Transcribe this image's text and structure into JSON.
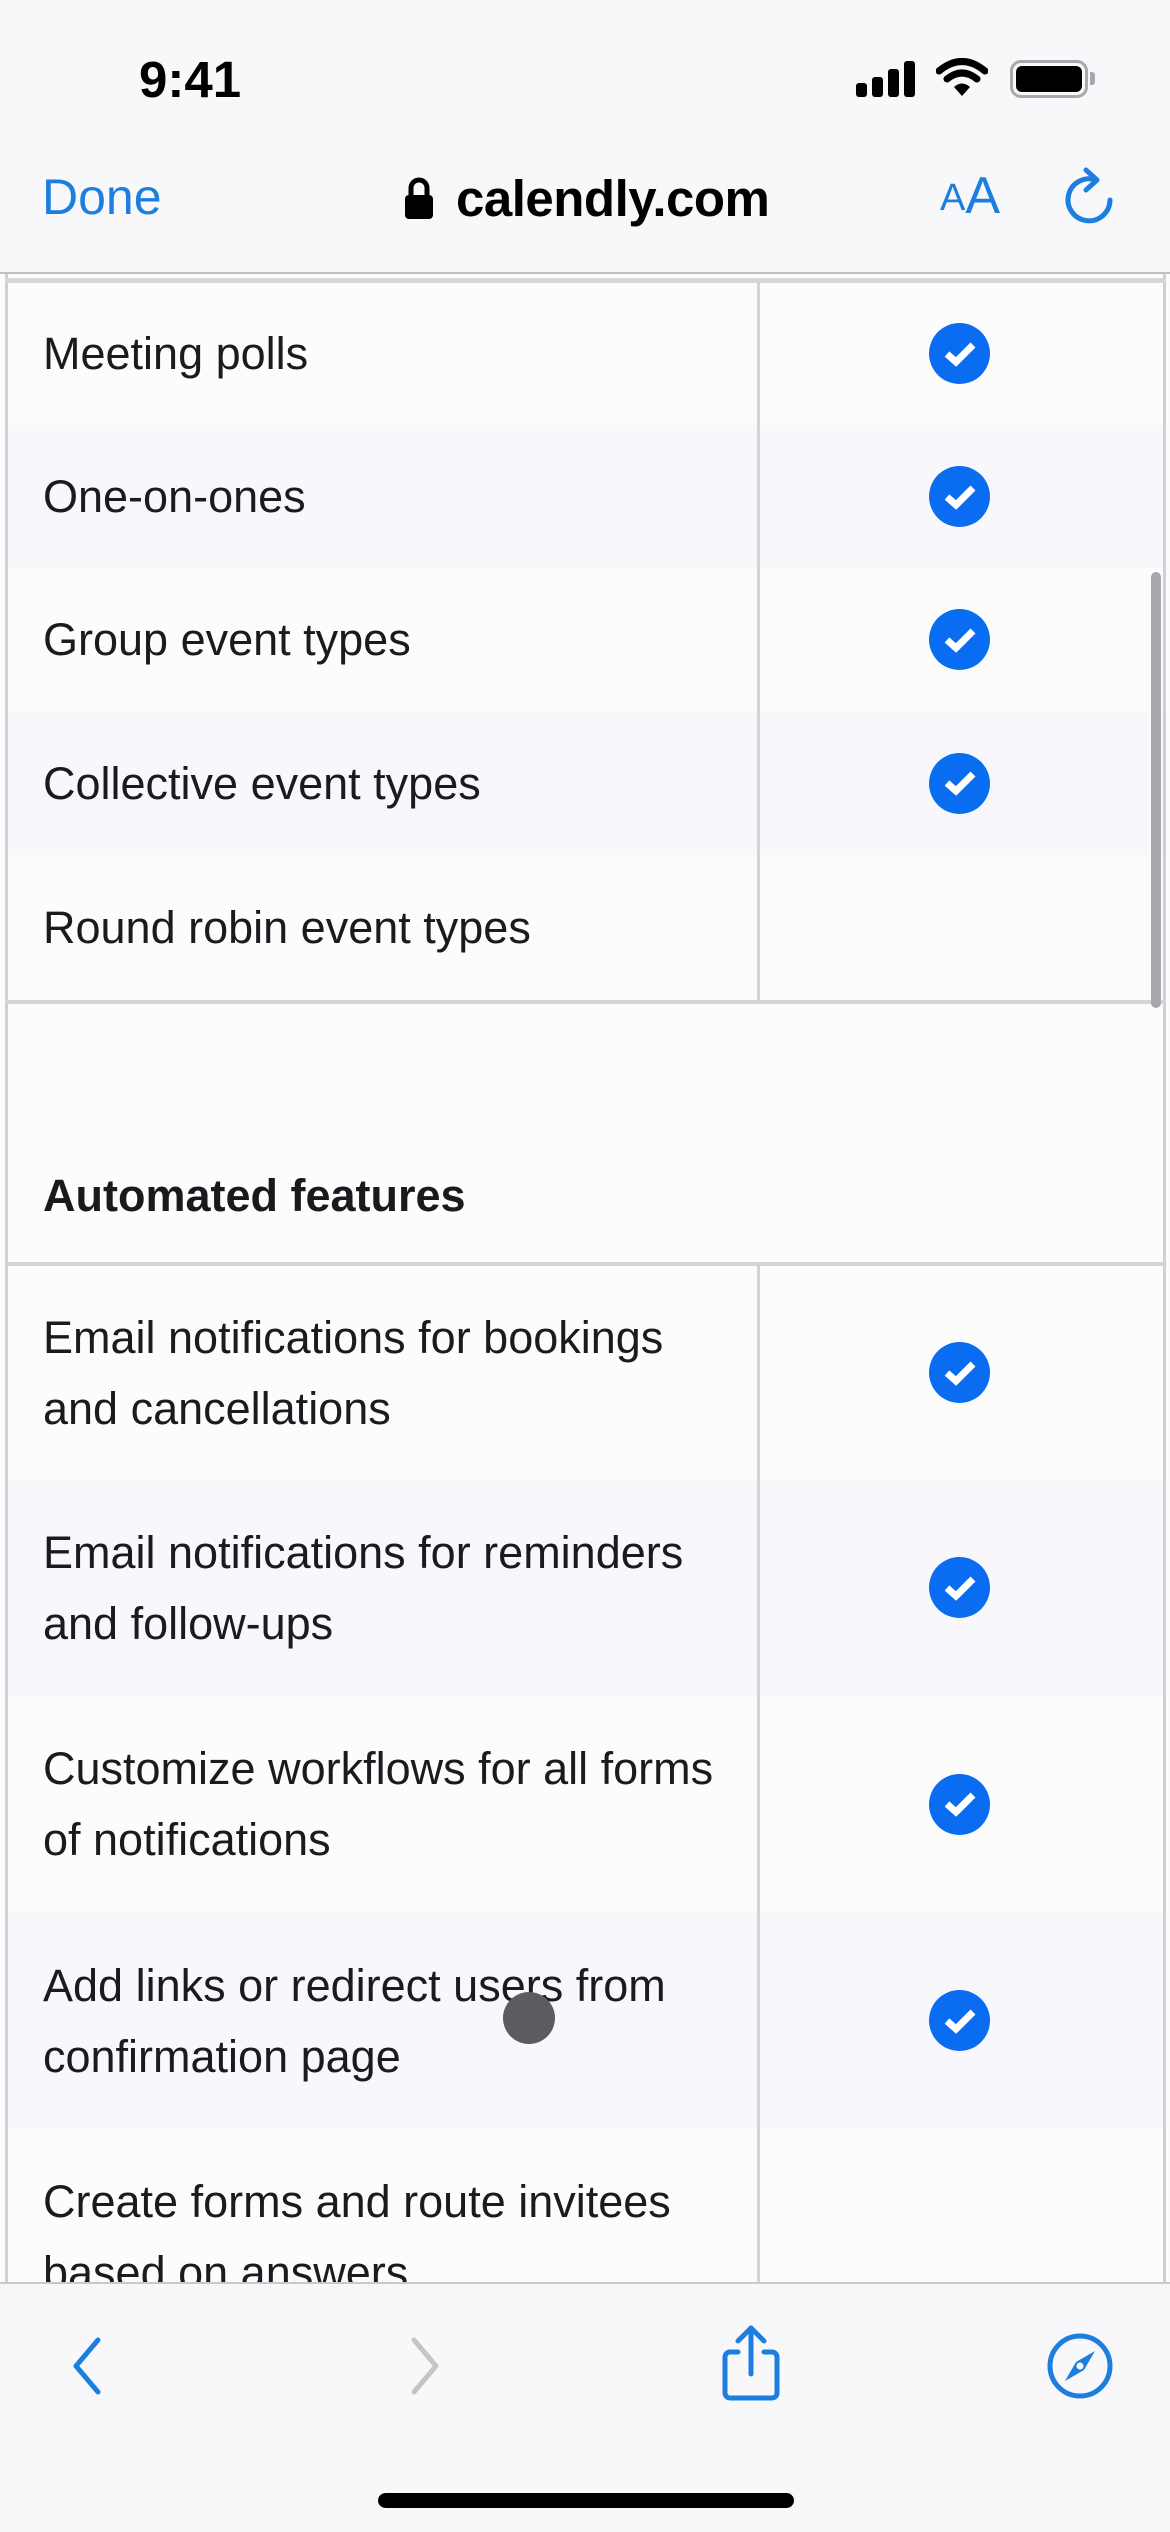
{
  "status_bar": {
    "time": "9:41",
    "signal_icon": "cellular-signal-icon",
    "wifi_icon": "wifi-icon",
    "battery_icon": "battery-icon"
  },
  "nav": {
    "done_label": "Done",
    "url": "calendly.com",
    "lock_icon": "lock-icon",
    "text_size_label_small": "A",
    "text_size_label_large": "A",
    "reload_icon": "reload-icon"
  },
  "table": {
    "section_1_rows": [
      {
        "label": "Meeting polls",
        "included": true
      },
      {
        "label": "One-on-ones",
        "included": true
      },
      {
        "label": "Group event types",
        "included": true
      },
      {
        "label": "Collective event types",
        "included": true
      },
      {
        "label": "Round robin event types",
        "included": false
      }
    ],
    "section_2_title": "Automated features",
    "section_2_rows": [
      {
        "label": "Email notifications for bookings and cancellations",
        "included": true
      },
      {
        "label": "Email notifications for reminders and follow-ups",
        "included": true
      },
      {
        "label": "Customize workflows for all forms of notifications",
        "included": true
      },
      {
        "label": "Add links or redirect users from confirmation page",
        "included": true
      },
      {
        "label": "Create forms and route invitees based on answers",
        "included": false
      }
    ],
    "check_icon": "check-circle-icon"
  },
  "toolbar": {
    "back_icon": "chevron-left-icon",
    "forward_icon": "chevron-right-icon",
    "share_icon": "share-icon",
    "compass_icon": "compass-icon"
  },
  "colors": {
    "accent": "#1c7fe0",
    "check_blue": "#0a6cf0",
    "row_stripe": "#f8f7fb",
    "border": "#d3d3d6",
    "disabled": "#c5c5c8"
  }
}
